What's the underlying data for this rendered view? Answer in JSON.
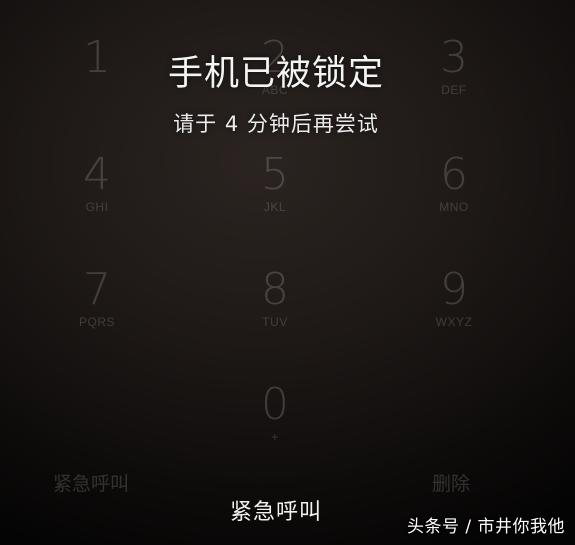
{
  "lock": {
    "title": "手机已被锁定",
    "subtitle": "请于 4 分钟后再尝试"
  },
  "keypad": {
    "keys": [
      {
        "digit": "1",
        "letters": ""
      },
      {
        "digit": "2",
        "letters": "ABC"
      },
      {
        "digit": "3",
        "letters": "DEF"
      },
      {
        "digit": "4",
        "letters": "GHI"
      },
      {
        "digit": "5",
        "letters": "JKL"
      },
      {
        "digit": "6",
        "letters": "MNO"
      },
      {
        "digit": "7",
        "letters": "PQRS"
      },
      {
        "digit": "8",
        "letters": "TUV"
      },
      {
        "digit": "9",
        "letters": "WXYZ"
      },
      {
        "digit": "0",
        "letters": "+"
      }
    ],
    "emergency_label": "紧急呼叫",
    "delete_label": "删除"
  },
  "emergency_call": {
    "label": "紧急呼叫"
  },
  "watermark": {
    "text": "头条号 / 市井你我他"
  }
}
